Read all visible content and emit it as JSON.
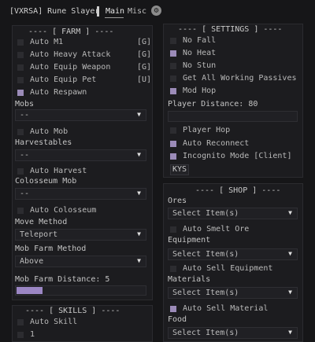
{
  "window": {
    "title": "[VXRSA] Rune Slayer",
    "tabs": [
      {
        "label": "Main"
      },
      {
        "label": "Misc"
      }
    ],
    "settings_icon": "gear-icon"
  },
  "farm": {
    "header": "---- [ FARM ] ----",
    "toggles": [
      {
        "label": "Auto M1",
        "key": "[G]",
        "checked": false
      },
      {
        "label": "Auto Heavy Attack",
        "key": "[G]",
        "checked": false
      },
      {
        "label": "Auto Equip Weapon",
        "key": "[G]",
        "checked": false
      },
      {
        "label": "Auto Equip Pet",
        "key": "[U]",
        "checked": false
      },
      {
        "label": "Auto Respawn",
        "key": "",
        "checked": true
      }
    ],
    "mobs_label": "Mobs",
    "mobs_value": "--",
    "auto_mob": "Auto Mob",
    "harvestables_label": "Harvestables",
    "harvestables_value": "--",
    "auto_harvest": "Auto Harvest",
    "colosseum_label": "Colosseum Mob",
    "colosseum_value": "--",
    "auto_colosseum": "Auto Colosseum",
    "move_method_label": "Move Method",
    "move_method_value": "Teleport",
    "mob_farm_method_label": "Mob Farm Method",
    "mob_farm_method_value": "Above",
    "distance_label": "Mob Farm Distance: 5",
    "distance_fraction": 0.2
  },
  "skills": {
    "header": "---- [ SKILLS ] ----",
    "auto_skill": "Auto Skill",
    "item2": "1"
  },
  "settings": {
    "header": "---- [ SETTINGS ] ----",
    "toggles": [
      {
        "label": "No Fall",
        "checked": false
      },
      {
        "label": "No Heat",
        "checked": true
      },
      {
        "label": "No Stun",
        "checked": false
      },
      {
        "label": "Get All Working Passives",
        "checked": false
      },
      {
        "label": "Mod Hop",
        "checked": true
      }
    ],
    "player_distance_label": "Player Distance: 80",
    "player_hop": "Player Hop",
    "auto_reconnect": "Auto Reconnect",
    "incognito": "Incognito Mode [Client]",
    "kys_button": "KYS"
  },
  "shop": {
    "header": "---- [ SHOP ] ----",
    "ores_label": "Ores",
    "ores_value": "Select Item(s)",
    "auto_smelt": "Auto Smelt Ore",
    "equipment_label": "Equipment",
    "equipment_value": "Select Item(s)",
    "auto_sell_equipment": "Auto Sell Equipment",
    "materials_label": "Materials",
    "materials_value": "Select Item(s)",
    "auto_sell_material": "Auto Sell Material",
    "food_label": "Food",
    "food_value": "Select Item(s)"
  },
  "colors": {
    "accent": "#9b86c4",
    "background": "#161618",
    "panel": "#1c1c1f"
  }
}
